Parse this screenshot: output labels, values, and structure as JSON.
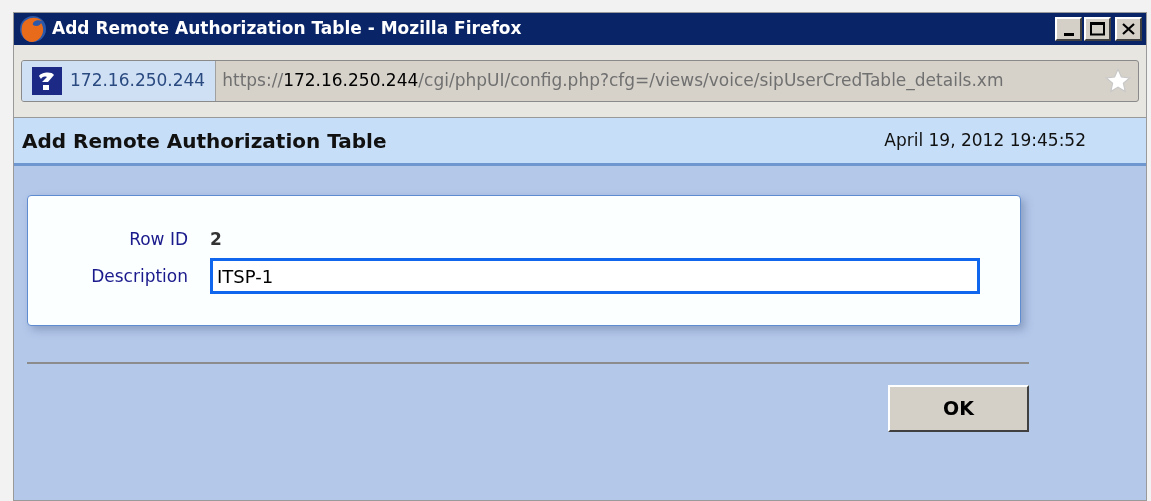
{
  "window": {
    "title": "Add Remote Authorization Table - Mozilla Firefox"
  },
  "address_bar": {
    "site_identity": "172.16.250.244",
    "url": {
      "scheme": "https://",
      "host": "172.16.250.244",
      "path": "/cgi/phpUI/config.php?cfg=/views/voice/sipUserCredTable_details.xm"
    }
  },
  "page": {
    "title": "Add Remote Authorization Table",
    "timestamp": "April 19, 2012 19:45:52"
  },
  "form": {
    "fields": [
      {
        "kind": "static",
        "label": "Row ID",
        "value": "2"
      },
      {
        "kind": "text",
        "label": "Description",
        "value": "ITSP-1",
        "focused": true
      }
    ]
  },
  "buttons": [
    "OK"
  ]
}
